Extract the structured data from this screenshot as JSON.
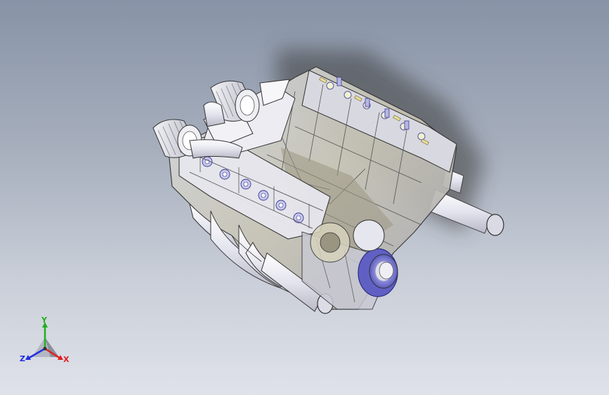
{
  "triad": {
    "x_label": "X",
    "y_label": "Y",
    "z_label": "Z",
    "x_color": "#e02020",
    "y_color": "#20b020",
    "z_color": "#2030e0"
  },
  "model": {
    "icon": "v8-engine-assembly"
  },
  "background": {
    "top_color": "#8793a6",
    "bottom_color": "#dfe2e9"
  }
}
